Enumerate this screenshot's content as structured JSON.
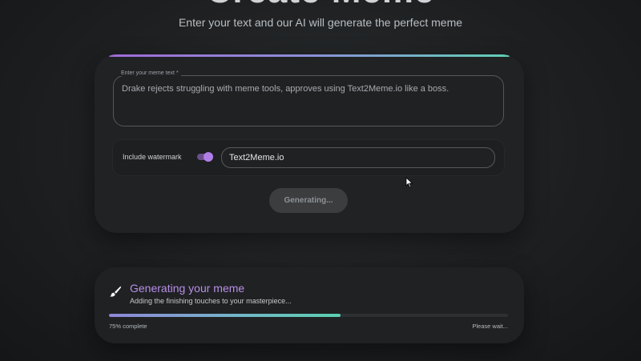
{
  "header": {
    "title": "Create Meme",
    "subtitle": "Enter your text and our AI will generate the perfect meme"
  },
  "form": {
    "meme_text_label": "Enter your meme text *",
    "meme_text_value": "Drake rejects struggling with meme tools, approves using Text2Meme.io like a boss.",
    "watermark_label": "Include watermark",
    "watermark_enabled": true,
    "watermark_value": "Text2Meme.io",
    "generate_button_label": "Generating...",
    "accent_colors": [
      "#a06bd6",
      "#8b8fd8",
      "#5fd0b5"
    ]
  },
  "status": {
    "icon": "brush-icon",
    "title": "Generating your meme",
    "subtitle": "Adding the finishing touches to your masterpiece...",
    "progress_fraction": 0.58,
    "progress_label": "75% complete",
    "wait_label": "Please wait..."
  }
}
